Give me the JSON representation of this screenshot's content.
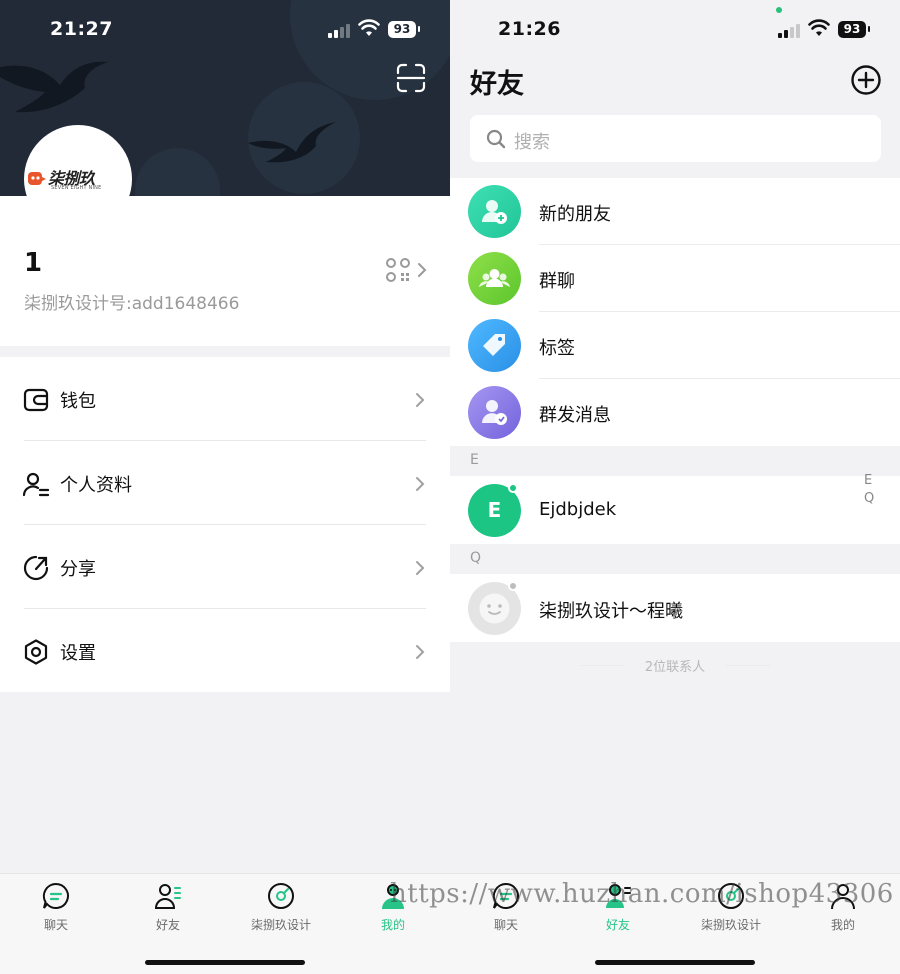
{
  "left": {
    "status": {
      "time": "21:27",
      "battery": "93"
    },
    "profile": {
      "name": "1",
      "id_text": "柒捌玖设计号:add1648466"
    },
    "brand": {
      "logo_text": "柒捌玖",
      "logo_sub": "SEVEN EIGHT NINE"
    },
    "menu": [
      {
        "label": "钱包",
        "icon": "wallet-icon"
      },
      {
        "label": "个人资料",
        "icon": "profile-icon"
      },
      {
        "label": "分享",
        "icon": "share-icon"
      },
      {
        "label": "设置",
        "icon": "settings-icon"
      }
    ],
    "tabs": [
      {
        "label": "聊天",
        "icon": "chat-icon",
        "active": false
      },
      {
        "label": "好友",
        "icon": "friends-icon",
        "active": false
      },
      {
        "label": "柒捌玖设计",
        "icon": "discover-icon",
        "active": false
      },
      {
        "label": "我的",
        "icon": "me-icon",
        "active": true
      }
    ]
  },
  "right": {
    "status": {
      "time": "21:26",
      "battery": "93"
    },
    "title": "好友",
    "search": {
      "placeholder": "搜索"
    },
    "functions": [
      {
        "label": "新的朋友",
        "icon": "new-friend-icon",
        "color": "#2fd3a6"
      },
      {
        "label": "群聊",
        "icon": "group-chat-icon",
        "color": "#7bd33c"
      },
      {
        "label": "标签",
        "icon": "tag-icon",
        "color": "#3aa7f2"
      },
      {
        "label": "群发消息",
        "icon": "broadcast-icon",
        "color": "#8a7be8"
      }
    ],
    "sections": [
      {
        "letter": "E",
        "contacts": [
          {
            "name": "Ejdbjdek",
            "avatar_letter": "E",
            "avatar_color": "#1cc584"
          }
        ]
      },
      {
        "letter": "Q",
        "contacts": [
          {
            "name": "柒捌玖设计～程曦",
            "avatar_color": "#e4e4e4"
          }
        ]
      }
    ],
    "index_letters": [
      "E",
      "Q"
    ],
    "contact_count": "2位联系人",
    "tabs": [
      {
        "label": "聊天",
        "icon": "chat-icon",
        "active": false
      },
      {
        "label": "好友",
        "icon": "friends-icon",
        "active": true
      },
      {
        "label": "柒捌玖设计",
        "icon": "discover-icon",
        "active": false
      },
      {
        "label": "我的",
        "icon": "me-icon",
        "active": false
      }
    ]
  },
  "watermark": "https://www.huzhan.com/ishop43306",
  "colors": {
    "accent": "#27c488",
    "header_bg": "#212a36"
  }
}
